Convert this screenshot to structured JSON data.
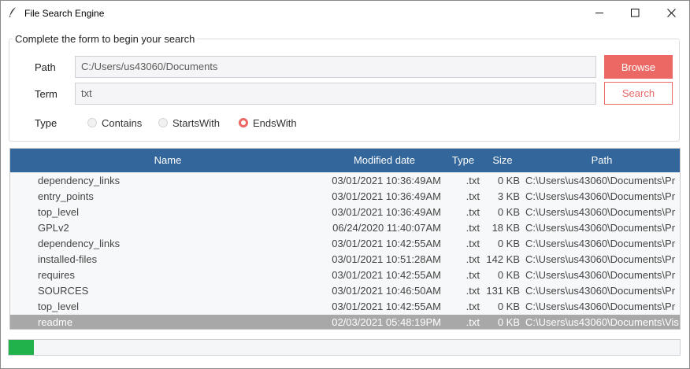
{
  "window": {
    "title": "File Search Engine",
    "icons": {
      "app": "feather-icon",
      "minimize": "minimize-icon",
      "maximize": "maximize-icon",
      "close": "close-icon"
    }
  },
  "form": {
    "legend": "Complete the form to begin your search",
    "path_label": "Path",
    "path_value": "C:/Users/us43060/Documents",
    "term_label": "Term",
    "term_value": "txt",
    "type_label": "Type",
    "browse_label": "Browse",
    "search_label": "Search",
    "options": [
      {
        "label": "Contains",
        "selected": false
      },
      {
        "label": "StartsWith",
        "selected": false
      },
      {
        "label": "EndsWith",
        "selected": true
      }
    ]
  },
  "table": {
    "columns": [
      "Name",
      "Modified date",
      "Type",
      "Size",
      "Path"
    ],
    "rows": [
      {
        "name": "dependency_links",
        "date": "03/01/2021 10:36:49AM",
        "type": ".txt",
        "size": "0 KB",
        "path": "C:\\Users\\us43060\\Documents\\Pr",
        "selected": false
      },
      {
        "name": "entry_points",
        "date": "03/01/2021 10:36:49AM",
        "type": ".txt",
        "size": "3 KB",
        "path": "C:\\Users\\us43060\\Documents\\Pr",
        "selected": false
      },
      {
        "name": "top_level",
        "date": "03/01/2021 10:36:49AM",
        "type": ".txt",
        "size": "0 KB",
        "path": "C:\\Users\\us43060\\Documents\\Pr",
        "selected": false
      },
      {
        "name": "GPLv2",
        "date": "06/24/2020 11:40:07AM",
        "type": ".txt",
        "size": "18 KB",
        "path": "C:\\Users\\us43060\\Documents\\Pr",
        "selected": false
      },
      {
        "name": "dependency_links",
        "date": "03/01/2021 10:42:55AM",
        "type": ".txt",
        "size": "0 KB",
        "path": "C:\\Users\\us43060\\Documents\\Pr",
        "selected": false
      },
      {
        "name": "installed-files",
        "date": "03/01/2021 10:51:28AM",
        "type": ".txt",
        "size": "142 KB",
        "path": "C:\\Users\\us43060\\Documents\\Pr",
        "selected": false
      },
      {
        "name": "requires",
        "date": "03/01/2021 10:42:55AM",
        "type": ".txt",
        "size": "0 KB",
        "path": "C:\\Users\\us43060\\Documents\\Pr",
        "selected": false
      },
      {
        "name": "SOURCES",
        "date": "03/01/2021 10:46:50AM",
        "type": ".txt",
        "size": "131 KB",
        "path": "C:\\Users\\us43060\\Documents\\Pr",
        "selected": false
      },
      {
        "name": "top_level",
        "date": "03/01/2021 10:42:55AM",
        "type": ".txt",
        "size": "0 KB",
        "path": "C:\\Users\\us43060\\Documents\\Pr",
        "selected": false
      },
      {
        "name": "readme",
        "date": "02/03/2021 05:48:19PM",
        "type": ".txt",
        "size": "0 KB",
        "path": "C:\\Users\\us43060\\Documents\\Vis",
        "selected": true
      }
    ]
  },
  "progress": {
    "fraction": 0.037,
    "color": "#22b24c"
  },
  "colors": {
    "accent": "#eb6864",
    "header": "#33669a",
    "selected_row": "#a8a8a8"
  }
}
